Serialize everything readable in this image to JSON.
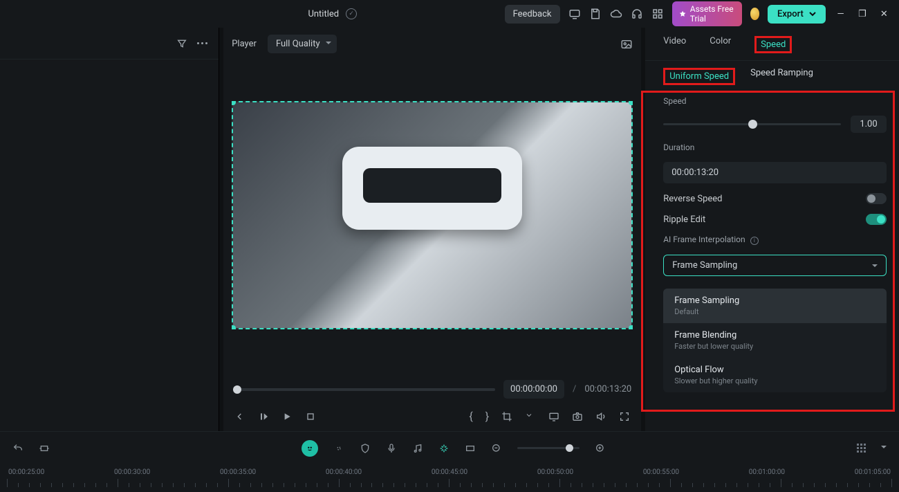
{
  "titlebar": {
    "doc_title": "Untitled",
    "feedback": "Feedback",
    "assets_trial": "Assets Free Trial",
    "export": "Export"
  },
  "preview": {
    "player_label": "Player",
    "quality": "Full Quality",
    "current_time": "00:00:00:00",
    "separator": "/",
    "total_time": "00:00:13:20"
  },
  "inspector": {
    "tabs": {
      "video": "Video",
      "color": "Color",
      "speed": "Speed"
    },
    "subtabs": {
      "uniform": "Uniform Speed",
      "ramping": "Speed Ramping"
    },
    "speed_label": "Speed",
    "speed_value": "1.00",
    "duration_label": "Duration",
    "duration_value": "00:00:13:20",
    "reverse_label": "Reverse Speed",
    "ripple_label": "Ripple Edit",
    "ai_interp_label": "AI Frame Interpolation",
    "dd_selected": "Frame Sampling",
    "dd_options": [
      {
        "title": "Frame Sampling",
        "sub": "Default"
      },
      {
        "title": "Frame Blending",
        "sub": "Faster but lower quality"
      },
      {
        "title": "Optical Flow",
        "sub": "Slower but higher quality"
      }
    ]
  },
  "timeline": {
    "labels": [
      "00:00:25:00",
      "00:00:30:00",
      "00:00:35:00",
      "00:00:40:00",
      "00:00:45:00",
      "00:00:50:00",
      "00:00:55:00",
      "00:01:00:00",
      "00:01:05:00"
    ]
  }
}
